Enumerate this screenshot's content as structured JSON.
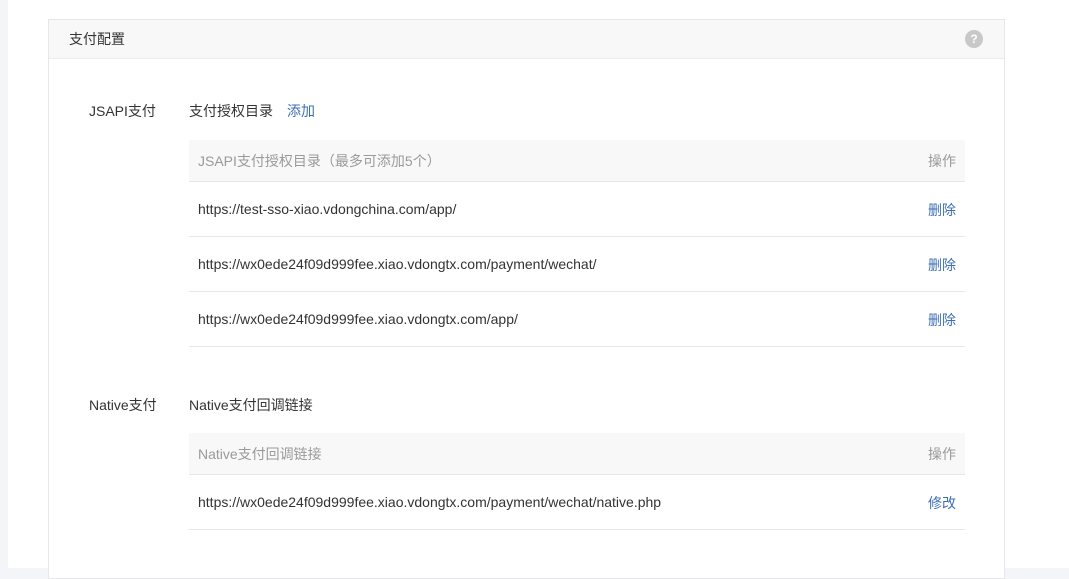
{
  "panel": {
    "title": "支付配置",
    "help_icon": "?"
  },
  "jsapi": {
    "label": "JSAPI支付",
    "subtitle": "支付授权目录",
    "add_label": "添加",
    "table": {
      "header_col1": "JSAPI支付授权目录（最多可添加5个）",
      "header_col2": "操作",
      "rows": [
        {
          "url": "https://test-sso-xiao.vdongchina.com/app/",
          "action": "删除"
        },
        {
          "url": "https://wx0ede24f09d999fee.xiao.vdongtx.com/payment/wechat/",
          "action": "删除"
        },
        {
          "url": "https://wx0ede24f09d999fee.xiao.vdongtx.com/app/",
          "action": "删除"
        }
      ]
    }
  },
  "native": {
    "label": "Native支付",
    "subtitle": "Native支付回调链接",
    "table": {
      "header_col1": "Native支付回调链接",
      "header_col2": "操作",
      "rows": [
        {
          "url": "https://wx0ede24f09d999fee.xiao.vdongtx.com/payment/wechat/native.php",
          "action": "修改"
        }
      ]
    }
  },
  "colors": {
    "link": "#3d6fb6",
    "header_bg": "#f8f8f8",
    "border": "#e7e7eb"
  }
}
